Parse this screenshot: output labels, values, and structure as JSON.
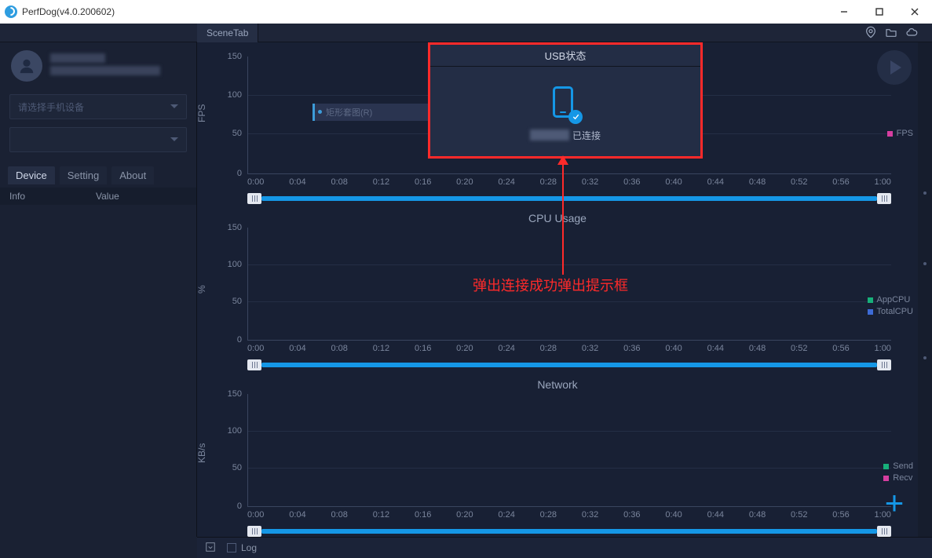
{
  "window": {
    "title": "PerfDog(v4.0.200602)"
  },
  "sidebar": {
    "device_placeholder": "请选择手机设备",
    "tabs": {
      "device": "Device",
      "setting": "Setting",
      "about": "About"
    },
    "info_cols": {
      "info": "Info",
      "value": "Value"
    }
  },
  "scene_tab": "SceneTab",
  "modal": {
    "title": "USB状态",
    "connected_suffix": "已连接"
  },
  "annotation": "弹出连接成功弹出提示框",
  "charts": {
    "fps": {
      "ylabel": "FPS",
      "yticks": [
        "150",
        "100",
        "50",
        "0"
      ],
      "rect_label": "矩形套图(R)",
      "legend": [
        {
          "label": "FPS",
          "color": "#d63ea0"
        }
      ]
    },
    "cpu": {
      "title": "CPU Usage",
      "ylabel": "%",
      "yticks": [
        "150",
        "100",
        "50",
        "0"
      ],
      "legend": [
        {
          "label": "AppCPU",
          "color": "#17b07a"
        },
        {
          "label": "TotalCPU",
          "color": "#3d6bd6"
        }
      ]
    },
    "net": {
      "title": "Network",
      "ylabel": "KB/s",
      "yticks": [
        "150",
        "100",
        "50",
        "0"
      ],
      "legend": [
        {
          "label": "Send",
          "color": "#17b07a"
        },
        {
          "label": "Recv",
          "color": "#d63ea0"
        }
      ]
    },
    "timeticks": [
      "0:00",
      "0:04",
      "0:08",
      "0:12",
      "0:16",
      "0:20",
      "0:24",
      "0:28",
      "0:32",
      "0:36",
      "0:40",
      "0:44",
      "0:48",
      "0:52",
      "0:56",
      "1:00"
    ]
  },
  "bottom": {
    "log_label": "Log"
  },
  "chart_data": [
    {
      "type": "line",
      "name": "FPS",
      "x_range": [
        "0:00",
        "1:00"
      ],
      "series": [
        {
          "name": "FPS",
          "values": []
        }
      ],
      "ylim": [
        0,
        150
      ],
      "ylabel": "FPS"
    },
    {
      "type": "line",
      "name": "CPU Usage",
      "x_range": [
        "0:00",
        "1:00"
      ],
      "series": [
        {
          "name": "AppCPU",
          "values": []
        },
        {
          "name": "TotalCPU",
          "values": []
        }
      ],
      "ylim": [
        0,
        150
      ],
      "ylabel": "%"
    },
    {
      "type": "line",
      "name": "Network",
      "x_range": [
        "0:00",
        "1:00"
      ],
      "series": [
        {
          "name": "Send",
          "values": []
        },
        {
          "name": "Recv",
          "values": []
        }
      ],
      "ylim": [
        0,
        150
      ],
      "ylabel": "KB/s"
    }
  ]
}
